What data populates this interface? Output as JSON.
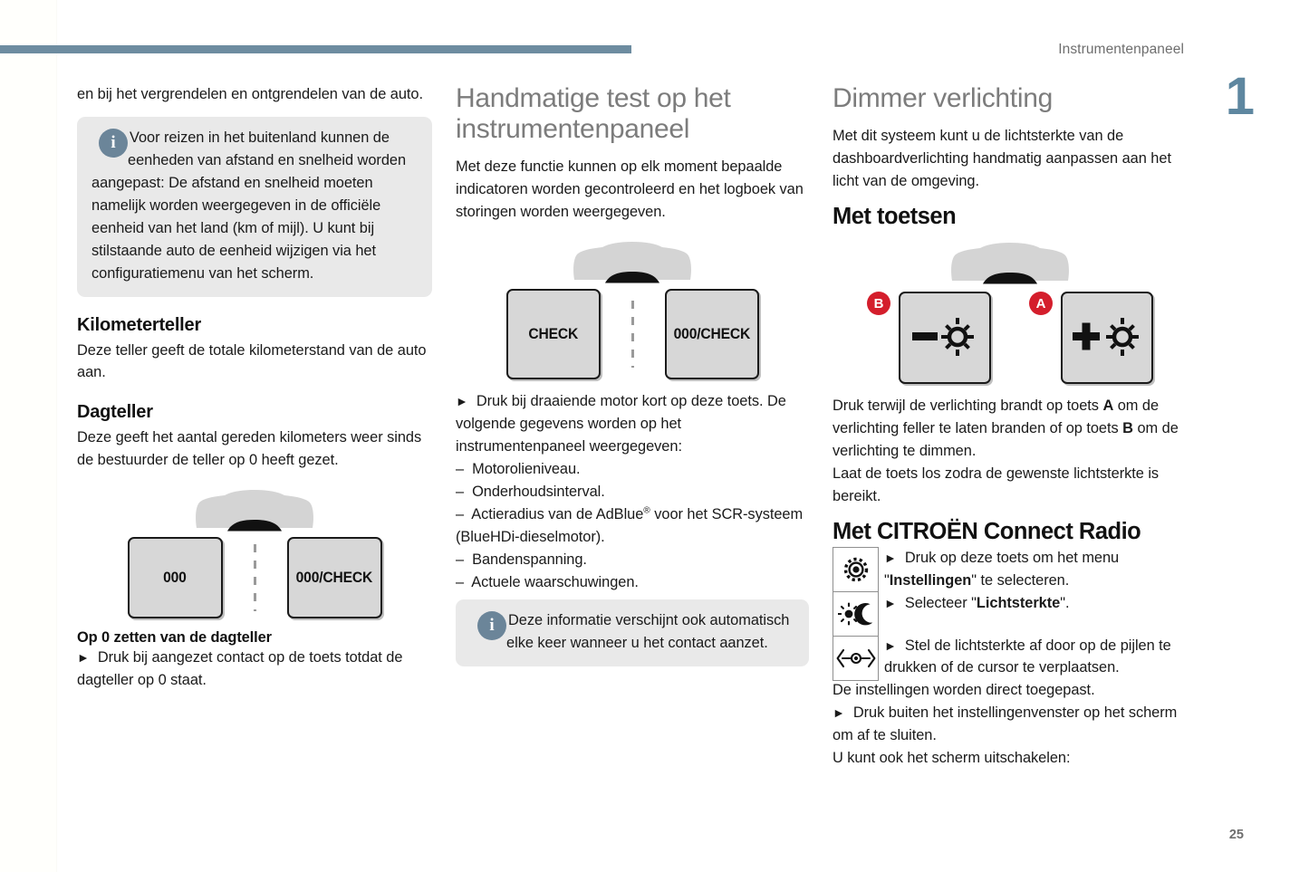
{
  "header": {
    "section_title": "Instrumentenpaneel",
    "chapter_number": "1",
    "page_number": "25",
    "rule_color": "#6d8ca0",
    "chapter_color": "#5e87a0"
  },
  "col1": {
    "intro": "en bij het vergrendelen en ontgrendelen van de auto.",
    "callout": {
      "icon": "info-icon",
      "text": "Voor reizen in het buitenland kunnen de eenheden van afstand en snelheid worden aangepast: De afstand en snelheid moeten namelijk worden weergegeven in de officiële eenheid van het land (km of mijl). U kunt bij stilstaande auto de eenheid wijzigen via het configuratiemenu van het scherm."
    },
    "h_kilometerteller": "Kilometerteller",
    "p_kilometerteller": "Deze teller geeft de totale kilometerstand van de auto aan.",
    "h_dagteller": "Dagteller",
    "p_dagteller": "Deze geeft het aantal gereden kilometers weer sinds de bestuurder de teller op 0 heeft gezet.",
    "figure": {
      "car": "car-front-silhouette",
      "button_left": "000",
      "button_right_bold": "000",
      "button_right_rest": "/CHECK"
    },
    "h_op0": "Op 0 zetten van de dagteller",
    "p_op0": "Druk bij aangezet contact op de toets totdat de dagteller op 0 staat."
  },
  "col2": {
    "title": "Handmatige test op het instrumentenpaneel",
    "intro": "Met deze functie kunnen op elk moment bepaalde indicatoren worden gecontroleerd en het logboek van storingen worden weergegeven.",
    "figure": {
      "car": "car-front-silhouette",
      "button_left": "CHECK",
      "button_right_bold": "000",
      "button_right_rest": "/CHECK"
    },
    "bullet": "Druk bij draaiende motor kort op deze toets. De volgende gegevens worden op het instrumentenpaneel weergegeven:",
    "list": [
      "Motorolieniveau.",
      "Onderhoudsinterval.",
      "Actieradius van de AdBlue® voor het SCR-systeem (BlueHDi-dieselmotor).",
      "Bandenspanning.",
      "Actuele waarschuwingen."
    ],
    "list_item3_pre": "Actieradius van de AdBlue",
    "list_item3_sup": "®",
    "list_item3_post": " voor het SCR-systeem (BlueHDi-dieselmotor).",
    "callout": {
      "icon": "info-icon",
      "text": "Deze informatie verschijnt ook automatisch elke keer wanneer u het contact aanzet."
    }
  },
  "col3": {
    "title": "Dimmer verlichting",
    "intro": "Met dit systeem kunt u de lichtsterkte van de dashboardverlichting handmatig aanpassen aan het licht van de omgeving.",
    "h_met_toetsen": "Met toetsen",
    "figure": {
      "car": "car-front-silhouette",
      "badge_left": "B",
      "badge_right": "A",
      "button_left_icon": "minus-brightness-icon",
      "button_right_icon": "plus-brightness-icon",
      "badge_color": "#d41e2c"
    },
    "p_dimmer_1_a": "Druk terwijl de verlichting brandt op toets ",
    "p_dimmer_1_b": "A",
    "p_dimmer_1_c": " om de verlichting feller te laten branden of op toets ",
    "p_dimmer_1_d": "B",
    "p_dimmer_1_e": " om de verlichting te dimmen.",
    "p_dimmer_2": "Laat de toets los zodra de gewenste lichtsterkte is bereikt.",
    "h_radio": "Met CITROËN Connect Radio",
    "radio_icons": [
      "settings-gear-icon",
      "sun-moon-brightness-icon",
      "slider-arrows-icon"
    ],
    "r_step1_a": "Druk op deze toets om het menu \"",
    "r_step1_b": "Instellingen",
    "r_step1_c": "\" te selecteren.",
    "r_step2_a": "Selecteer \"",
    "r_step2_b": "Lichtsterkte",
    "r_step2_c": "\".",
    "r_step3": "Stel de lichtsterkte af door op de pijlen te drukken of de cursor te verplaatsen.",
    "r_note": "De instellingen worden direct toegepast.",
    "r_step4": "Druk buiten het instellingenvenster op het scherm om af te sluiten.",
    "r_tail": "U kunt ook het scherm uitschakelen:"
  },
  "glyphs": {
    "triangle": "►",
    "dash": "–"
  }
}
